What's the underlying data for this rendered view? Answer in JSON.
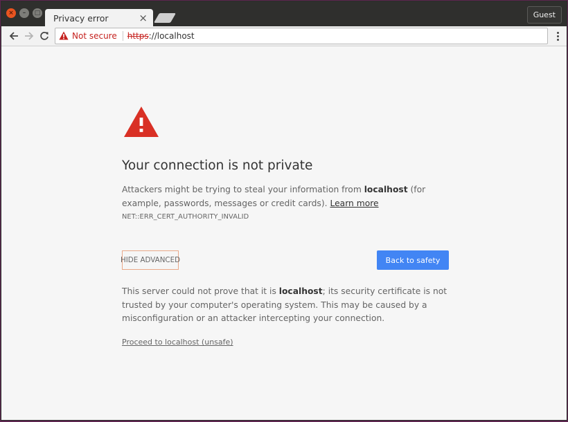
{
  "colors": {
    "accent": "#4285f4",
    "danger": "#d93025",
    "desktop": "#5e2750"
  },
  "tab": {
    "title": "Privacy error",
    "close_glyph": "×"
  },
  "window_controls": {
    "close_glyph": "×",
    "min_glyph": "–",
    "max_glyph": "□"
  },
  "profile": {
    "label": "Guest"
  },
  "toolbar": {
    "security_label": "Not secure",
    "url_scheme": "https",
    "url_rest": "://localhost"
  },
  "interstitial": {
    "heading": "Your connection is not private",
    "explanation_part1": "Attackers might be trying to steal your information from ",
    "explanation_host": "localhost",
    "explanation_part2": " (for example, passwords, messages or credit cards). ",
    "learn_more": "Learn more",
    "error_code": "NET::ERR_CERT_AUTHORITY_INVALID",
    "hide_advanced": "HIDE ADVANCED",
    "back_to_safety": "Back to safety",
    "details_part1": "This server could not prove that it is ",
    "details_host": "localhost",
    "details_part2": "; its security certificate is not trusted by your computer's operating system. This may be caused by a misconfiguration or an attacker intercepting your connection.",
    "proceed_link": "Proceed to localhost (unsafe)"
  },
  "icons": {
    "back": "arrow-left-icon",
    "forward": "arrow-right-icon",
    "reload": "reload-icon",
    "warning": "warning-triangle-icon",
    "menu": "more-vertical-icon"
  }
}
